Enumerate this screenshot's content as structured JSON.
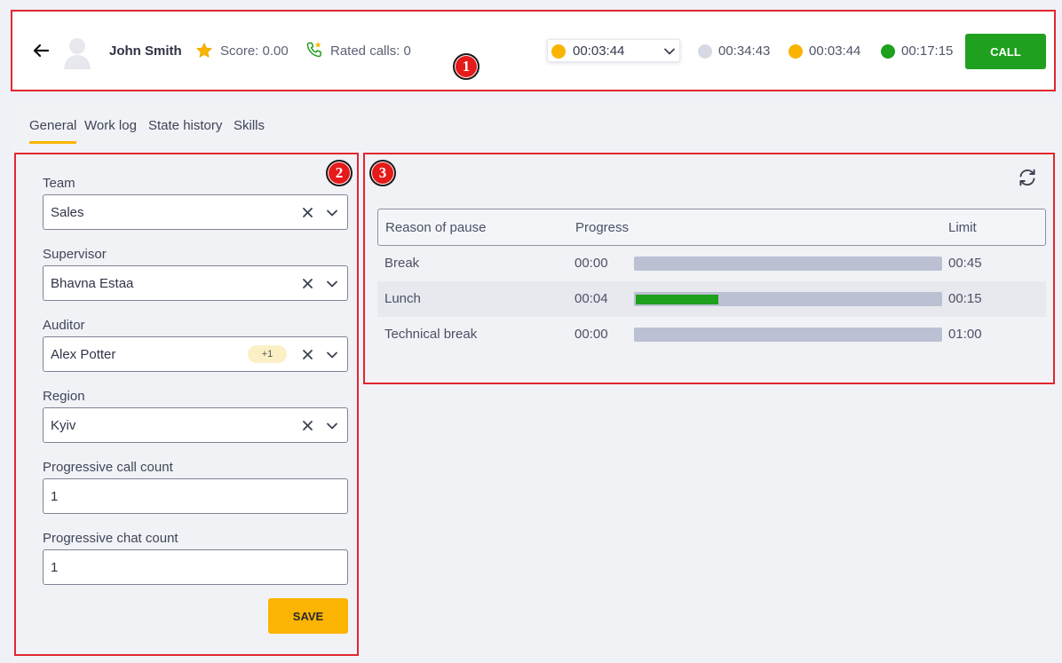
{
  "header": {
    "agent_name": "John Smith",
    "score": "Score: 0.00",
    "rated_calls": "Rated calls: 0",
    "status_select": {
      "value": "00:03:44",
      "color": "#f8b400"
    },
    "timers": [
      {
        "value": "00:34:43",
        "color": "#d6d9e3"
      },
      {
        "value": "00:03:44",
        "color": "#f8b400"
      },
      {
        "value": "00:17:15",
        "color": "#1fa01f"
      }
    ],
    "call_label": "CALL",
    "icons": {
      "back": "arrow-left-icon",
      "avatar": "user-avatar-icon",
      "score": "star-icon",
      "rated": "phone-star-icon"
    }
  },
  "markers": [
    "1",
    "2",
    "3"
  ],
  "tabs": [
    {
      "label": "General",
      "active": true
    },
    {
      "label": "Work log",
      "active": false
    },
    {
      "label": "State history",
      "active": false
    },
    {
      "label": "Skills",
      "active": false
    }
  ],
  "form": {
    "team": {
      "label": "Team",
      "value": "Sales"
    },
    "supervisor": {
      "label": "Supervisor",
      "value": "Bhavna Estaa"
    },
    "auditor": {
      "label": "Auditor",
      "value": "Alex Potter",
      "extra_badge": "+1"
    },
    "region": {
      "label": "Region",
      "value": "Kyiv"
    },
    "progressive_call_count": {
      "label": "Progressive call count",
      "value": "1"
    },
    "progressive_chat_count": {
      "label": "Progressive chat count",
      "value": "1"
    },
    "save_label": "SAVE"
  },
  "pause_table": {
    "headers": {
      "reason": "Reason of pause",
      "progress": "Progress",
      "limit": "Limit"
    },
    "rows": [
      {
        "reason": "Break",
        "elapsed": "00:00",
        "limit": "00:45",
        "progress_pct": 0
      },
      {
        "reason": "Lunch",
        "elapsed": "00:04",
        "limit": "00:15",
        "progress_pct": 27
      },
      {
        "reason": "Technical break",
        "elapsed": "00:00",
        "limit": "01:00",
        "progress_pct": 0
      }
    ]
  },
  "colors": {
    "accent_yellow": "#f8b400",
    "call_green": "#1fa01f",
    "marker_red": "#e3262e"
  }
}
